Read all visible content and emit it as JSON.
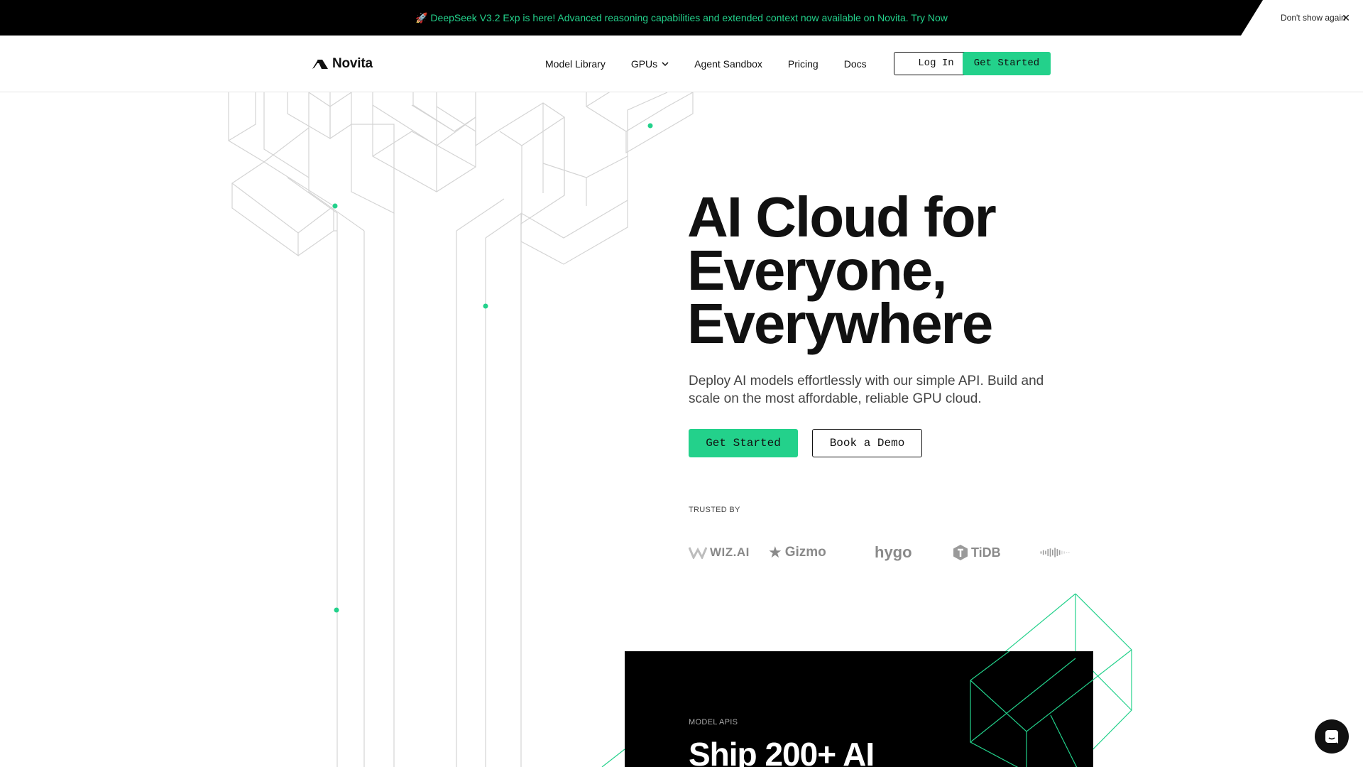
{
  "announcement": {
    "icon": "rocket-icon",
    "text": "🚀 DeepSeek V3.2 Exp is here! Advanced reasoning capabilities and extended context now available on Novita. Try Now",
    "dismiss_label": "Don't show again",
    "close_glyph": "✕",
    "text_color": "#23d18b"
  },
  "nav": {
    "brand": "Novita",
    "links": [
      "Model Library",
      "GPUs",
      "Agent Sandbox",
      "Pricing",
      "Docs"
    ],
    "login": "Log In",
    "get_started": "Get Started"
  },
  "hero": {
    "title_lines": [
      "AI Cloud for",
      "Everyone,",
      "Everywhere"
    ],
    "subtitle": "Deploy AI models effortlessly with our simple API. Build and scale on the most affordable, reliable GPU cloud.",
    "primary_cta": "Get Started",
    "secondary_cta": "Book a Demo",
    "trusted_label": "TRUSTED BY",
    "trusted_logos": [
      "WIZ.AI",
      "Gizmo",
      "hygo",
      "TiDB"
    ]
  },
  "card": {
    "label": "MODEL APIS",
    "title": "Ship 200+ AI"
  },
  "colors": {
    "accent": "#23d18b",
    "text": "#111111",
    "bar": "#000000"
  }
}
